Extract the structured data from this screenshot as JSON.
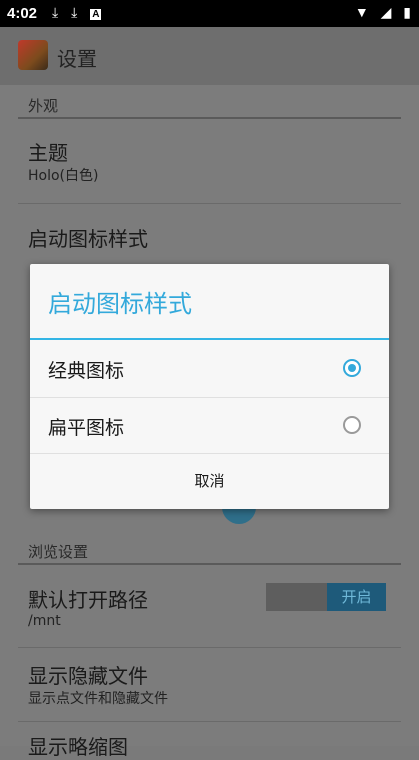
{
  "status_bar": {
    "time": "4:02",
    "left_icons": [
      "download-icon",
      "download-icon",
      "text-a-icon"
    ],
    "right_icons": [
      "wifi-icon",
      "signal-icon",
      "battery-icon"
    ]
  },
  "app_bar": {
    "title": "设置"
  },
  "sections": {
    "appearance": {
      "header": "外观",
      "theme_title": "主题",
      "theme_value": "Holo(白色)",
      "launcher_icon_title": "启动图标样式"
    },
    "browse": {
      "header": "浏览设置",
      "default_path_title": "默认打开路径",
      "default_path_value": "/mnt",
      "show_hidden_title": "显示隐藏文件",
      "show_hidden_sub": "显示点文件和隐藏文件",
      "show_hidden_switch": "开启",
      "thumbnail_title": "显示略缩图"
    }
  },
  "dialog": {
    "title": "启动图标样式",
    "options": [
      {
        "label": "经典图标",
        "checked": true
      },
      {
        "label": "扁平图标",
        "checked": false
      }
    ],
    "cancel": "取消"
  },
  "colors": {
    "accent": "#33b5e5"
  }
}
